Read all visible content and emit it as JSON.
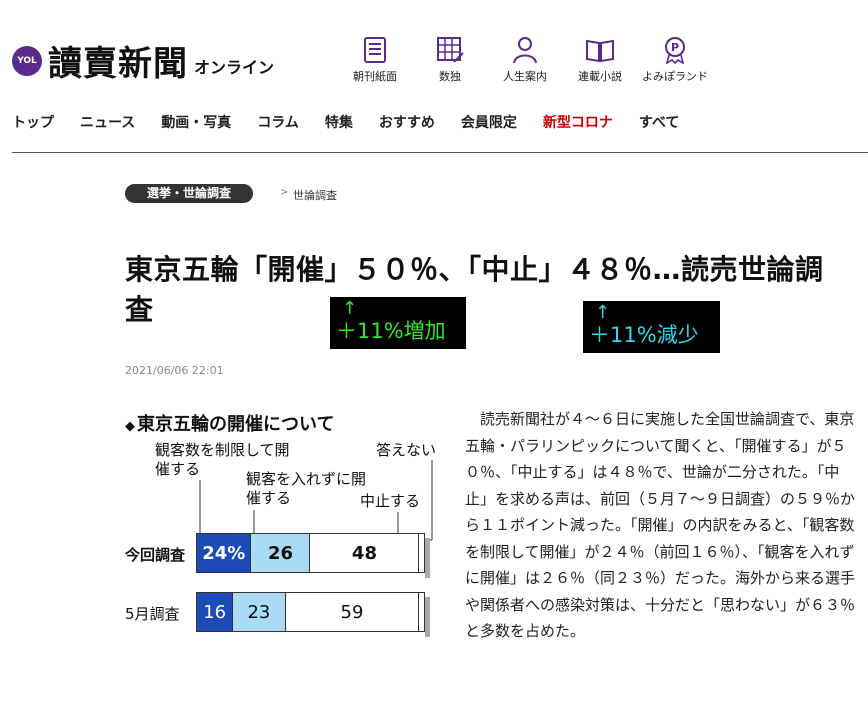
{
  "header": {
    "logo_badge": "YOL",
    "logo_name": "讀賣新聞",
    "logo_sub": "オンライン",
    "services": [
      {
        "label": "朝刊紙面",
        "icon": "newspaper-icon"
      },
      {
        "label": "数独",
        "icon": "sudoku-grid-icon"
      },
      {
        "label": "人生案内",
        "icon": "person-icon"
      },
      {
        "label": "連載小説",
        "icon": "book-icon"
      },
      {
        "label": "よみぽランド",
        "icon": "points-badge-icon"
      }
    ],
    "nav": [
      "トップ",
      "ニュース",
      "動画・写真",
      "コラム",
      "特集",
      "おすすめ",
      "会員限定",
      "新型コロナ",
      "すべて"
    ],
    "accent_color": "#cc0000"
  },
  "breadcrumb": {
    "category": "選挙・世論調査",
    "separator": ">",
    "current": "世論調査"
  },
  "article": {
    "headline": "東京五輪「開催」５０％、「中止」４８％…読売世論調査",
    "date": "2021/06/06 22:01",
    "body": "読売新聞社が４～６日に実施した全国世論調査で、東京五輪・パラリンピックについて聞くと、「開催する」が５０％、「中止する」は４８％で、世論が二分された。「中止」を求める声は、前回（５月７～９日調査）の５９％から１１ポイント減った。「開催」の内訳をみると、「観客数を制限して開催」が２４％（前回１６％）、「観客を入れずに開催」は２６％（同２３％）だった。海外から来る選手や関係者への感染対策は、十分だと「思わない」が６３％と多数を占めた。"
  },
  "annotations": {
    "note1_arrow": "↑",
    "note1_text": "＋11%増加",
    "note2_arrow": "↑",
    "note2_text": "＋11%減少"
  },
  "chart_data": {
    "type": "bar",
    "title": "東京五輪の開催について",
    "legend": {
      "s1": "観客数を制限して開催する",
      "s2": "観客を入れずに開催する",
      "s3": "中止する",
      "s4": "答えない"
    },
    "categories": [
      "今回調査",
      "5月調査"
    ],
    "series": [
      {
        "name": "観客数を制限して開催する",
        "values": [
          24,
          16
        ],
        "labels": [
          "24%",
          "16"
        ],
        "color": "#1c4bb8"
      },
      {
        "name": "観客を入れずに開催する",
        "values": [
          26,
          23
        ],
        "labels": [
          "26",
          "23"
        ],
        "color": "#a9daf6"
      },
      {
        "name": "中止する",
        "values": [
          48,
          59
        ],
        "labels": [
          "48",
          "59"
        ],
        "color": "#ffffff"
      },
      {
        "name": "答えない",
        "values": [
          2,
          2
        ],
        "labels": [
          "",
          ""
        ],
        "color": "#ffffff"
      }
    ]
  }
}
